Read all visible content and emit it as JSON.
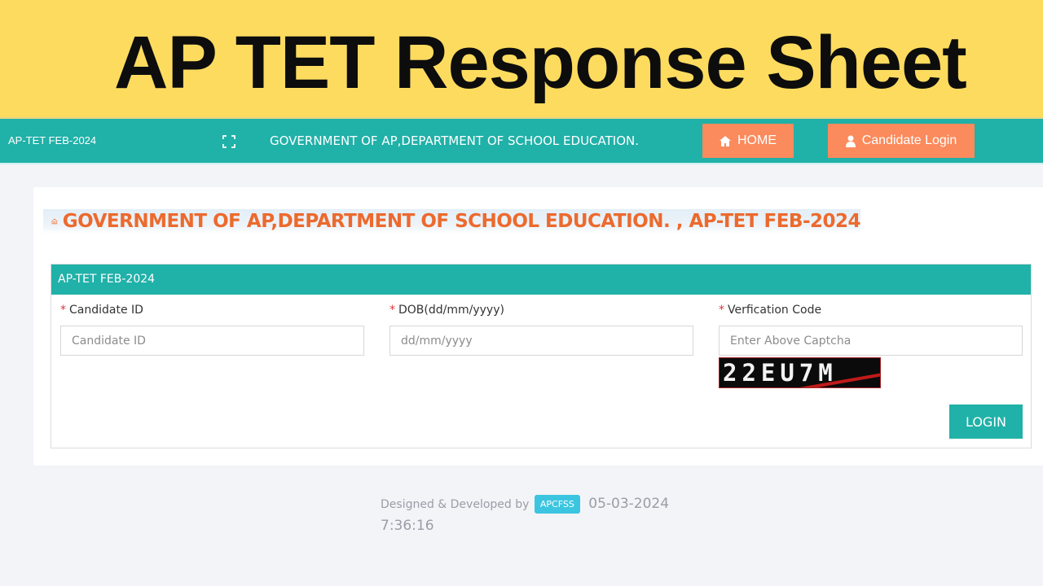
{
  "banner": {
    "title": "AP TET Response Sheet"
  },
  "navbar": {
    "brand": "AP-TET FEB-2024",
    "expand_icon": "expand-icon",
    "department": "GOVERNMENT OF AP,DEPARTMENT OF SCHOOL EDUCATION.",
    "home_label": "HOME",
    "home_icon": "home-icon",
    "candidate_login_label": "Candidate Login",
    "candidate_login_icon": "user-icon"
  },
  "main": {
    "headline": "GOVERNMENT OF AP,DEPARTMENT OF SCHOOL EDUCATION. , AP-TET FEB-2024",
    "panel_title": "AP-TET FEB-2024",
    "fields": [
      {
        "label": "Candidate ID",
        "placeholder": "Candidate ID",
        "value": ""
      },
      {
        "label": "DOB(dd/mm/yyyy)",
        "placeholder": "dd/mm/yyyy",
        "value": ""
      },
      {
        "label": "Verfication Code",
        "placeholder": "Enter Above Captcha",
        "value": ""
      }
    ],
    "required_mark": "*",
    "captcha_text": "22EU7M",
    "login_button": "LOGIN"
  },
  "footer": {
    "designed_by": "Designed & Developed by",
    "badge": "APCFSS",
    "date": "05-03-2024",
    "time": "7:36:16"
  },
  "colors": {
    "teal": "#20b1a8",
    "orange": "#fb8a5c",
    "headline": "#ec6a2e",
    "banner": "#fddb5f"
  }
}
